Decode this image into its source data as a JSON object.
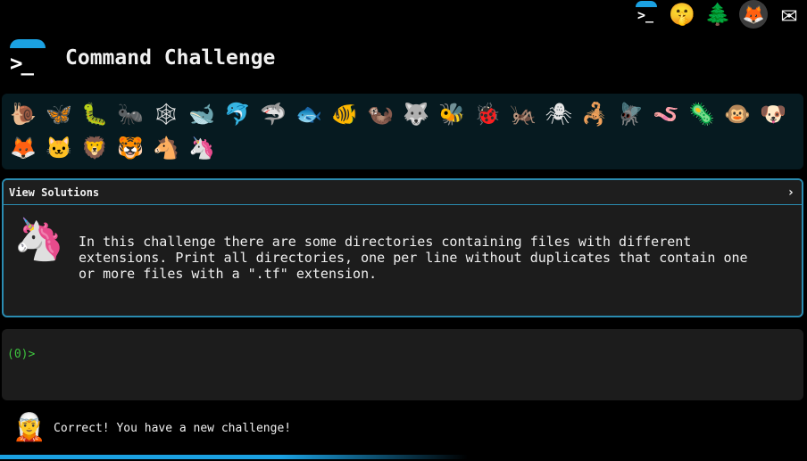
{
  "top_icons": [
    {
      "name": "terminal-icon",
      "glyph": ">_"
    },
    {
      "name": "shushing-face-icon",
      "glyph": "🤫"
    },
    {
      "name": "tree-icon",
      "glyph": "🌲"
    },
    {
      "name": "gitlab-icon",
      "glyph": "🦊"
    },
    {
      "name": "mail-icon",
      "glyph": "✉"
    }
  ],
  "header": {
    "logo_prompt": ">_",
    "title": "Command Challenge"
  },
  "animals": [
    {
      "name": "snail-icon",
      "glyph": "🐌"
    },
    {
      "name": "butterfly-icon",
      "glyph": "🦋"
    },
    {
      "name": "caterpillar-icon",
      "glyph": "🐛"
    },
    {
      "name": "ant-icon",
      "glyph": "🐜"
    },
    {
      "name": "spider-web-icon",
      "glyph": "🕸"
    },
    {
      "name": "whale-icon",
      "glyph": "🐋"
    },
    {
      "name": "dolphin-icon",
      "glyph": "🐬"
    },
    {
      "name": "shark-icon",
      "glyph": "🦈"
    },
    {
      "name": "fish-icon",
      "glyph": "🐟"
    },
    {
      "name": "tropical-fish-icon",
      "glyph": "🐠"
    },
    {
      "name": "otter-icon",
      "glyph": "🦦"
    },
    {
      "name": "wolf-icon",
      "glyph": "🐺"
    },
    {
      "name": "bee-icon",
      "glyph": "🐝"
    },
    {
      "name": "ladybug-icon",
      "glyph": "🐞"
    },
    {
      "name": "cricket-icon",
      "glyph": "🦗"
    },
    {
      "name": "spider-icon",
      "glyph": "🕷"
    },
    {
      "name": "scorpion-icon",
      "glyph": "🦂"
    },
    {
      "name": "fly-icon",
      "glyph": "🪰"
    },
    {
      "name": "worm-icon",
      "glyph": "🪱"
    },
    {
      "name": "microbe-icon",
      "glyph": "🦠"
    },
    {
      "name": "monkey-icon",
      "glyph": "🐵"
    },
    {
      "name": "dog-icon",
      "glyph": "🐶"
    },
    {
      "name": "fox-icon",
      "glyph": "🦊"
    },
    {
      "name": "cat-icon",
      "glyph": "🐱"
    },
    {
      "name": "lion-icon",
      "glyph": "🦁"
    },
    {
      "name": "tiger-icon",
      "glyph": "🐯"
    },
    {
      "name": "horse-icon",
      "glyph": "🐴"
    },
    {
      "name": "unicorn-icon",
      "glyph": "🦄"
    }
  ],
  "solutions_panel": {
    "title": "View Solutions",
    "chevron": "›",
    "avatar_glyph": "🦄",
    "challenge_text": "In this challenge there are some directories containing files with different\nextensions. Print all directories, one per line without duplicates that contain one\nor more files with a \".tf\" extension."
  },
  "terminal": {
    "prompt": "(0)>",
    "input_value": ""
  },
  "status": {
    "avatar_glyph": "🧝",
    "message": "Correct! You have a new challenge!"
  },
  "colors": {
    "background": "#000000",
    "accent": "#1ba1e2",
    "panel_border": "#2a8bb0",
    "prompt_green": "#3ec43e",
    "animal_strip_bg": "#061a20"
  }
}
